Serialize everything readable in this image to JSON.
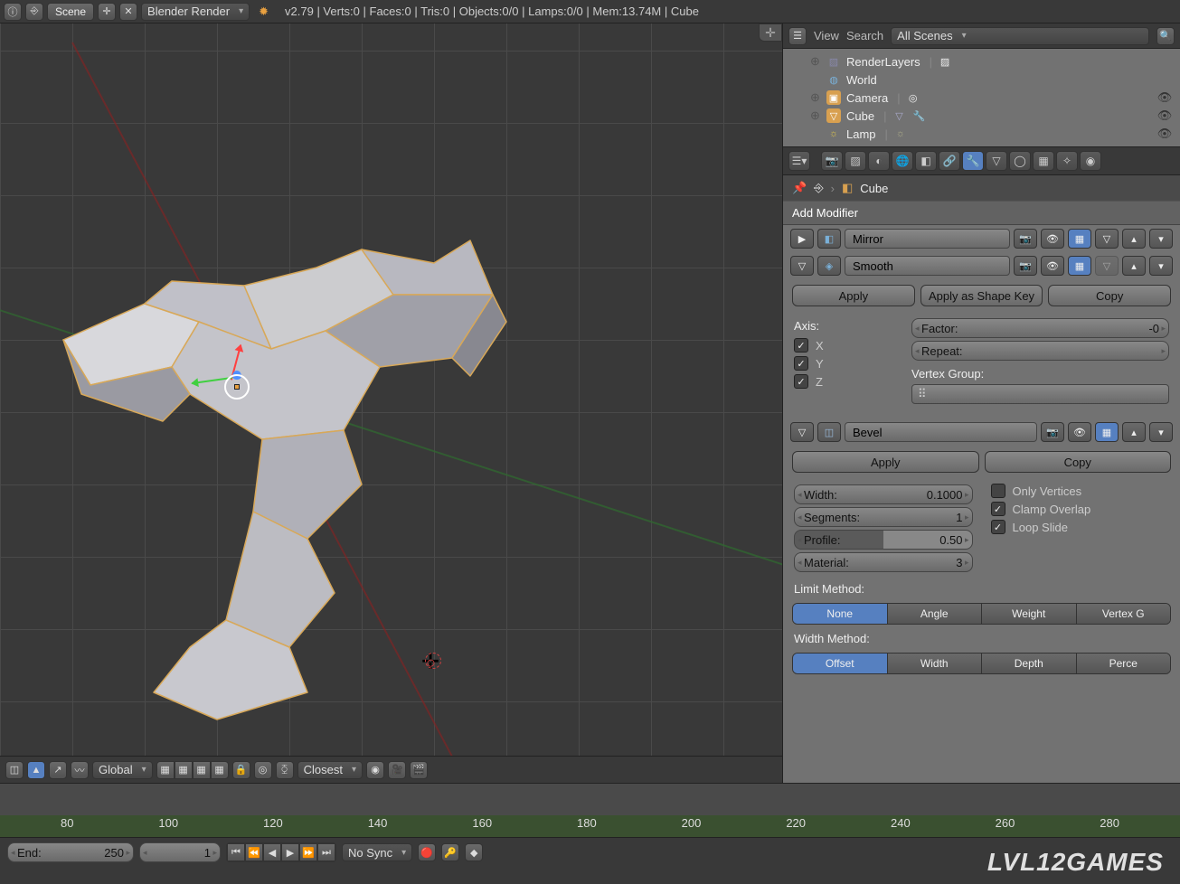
{
  "topbar": {
    "scene_label": "Scene",
    "renderer": "Blender Render",
    "stats": "v2.79 | Verts:0 | Faces:0 | Tris:0 | Objects:0/0 | Lamps:0/0 | Mem:13.74M | Cube"
  },
  "outliner": {
    "view": "View",
    "search": "Search",
    "scene_selector": "All Scenes",
    "items": [
      {
        "expand": "⊕",
        "icon": "▨",
        "name": "RenderLayers",
        "color": "#c8c8d8"
      },
      {
        "expand": "",
        "icon": "◍",
        "name": "World",
        "color": "#7ab0d8"
      },
      {
        "expand": "⊕",
        "icon": "▣",
        "name": "Camera",
        "color": "#d8a050"
      },
      {
        "expand": "⊕",
        "icon": "▽",
        "name": "Cube",
        "color": "#d8a050"
      },
      {
        "expand": "",
        "icon": "☼",
        "name": "Lamp",
        "color": "#d8c050"
      }
    ]
  },
  "breadcrumb": {
    "object": "Cube"
  },
  "add_modifier": "Add Modifier",
  "modifiers": [
    {
      "name": "Mirror",
      "expanded": false,
      "icon": "◧"
    },
    {
      "name": "Smooth",
      "expanded": true,
      "icon": "◈",
      "apply": "Apply",
      "apply_shape": "Apply as Shape Key",
      "copy": "Copy",
      "axis_label": "Axis:",
      "x": "X",
      "y": "Y",
      "z": "Z",
      "factor_label": "Factor:",
      "factor_val": "-0",
      "repeat_label": "Repeat:",
      "vgroup_label": "Vertex Group:"
    },
    {
      "name": "Bevel",
      "expanded": true,
      "icon": "◫",
      "apply": "Apply",
      "copy": "Copy",
      "width_label": "Width:",
      "width_val": "0.1000",
      "segments_label": "Segments:",
      "segments_val": "1",
      "profile_label": "Profile:",
      "profile_val": "0.50",
      "material_label": "Material:",
      "material_val": "3",
      "only_vertices": "Only Vertices",
      "clamp_overlap": "Clamp Overlap",
      "loop_slide": "Loop Slide",
      "limit_label": "Limit Method:",
      "limit_tabs": [
        "None",
        "Angle",
        "Weight",
        "Vertex G"
      ],
      "width_method_label": "Width Method:",
      "width_tabs": [
        "Offset",
        "Width",
        "Depth",
        "Perce"
      ]
    }
  ],
  "viewport_toolbar": {
    "orientation": "Global",
    "snap": "Closest"
  },
  "timeline": {
    "marks": [
      "80",
      "100",
      "120",
      "140",
      "160",
      "180",
      "200",
      "220",
      "240",
      "260",
      "280"
    ],
    "end_label": "End:",
    "end_val": "250",
    "frame": "1",
    "playback": "No Sync"
  },
  "watermark": "LVL12GAMES"
}
